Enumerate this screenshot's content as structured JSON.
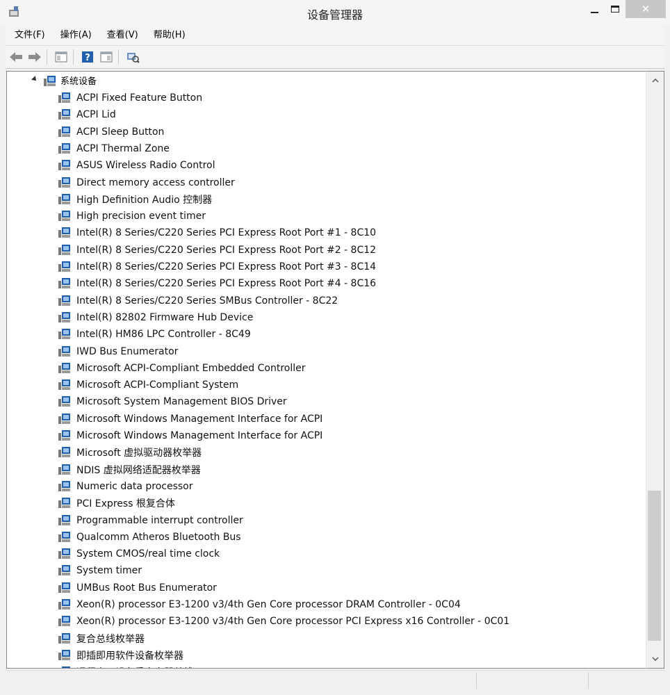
{
  "window": {
    "title": "设备管理器",
    "close_glyph": "✕"
  },
  "menu": [
    "文件(F)",
    "操作(A)",
    "查看(V)",
    "帮助(H)"
  ],
  "toolbar": {
    "buttons": [
      "back-arrow-icon",
      "forward-arrow-icon",
      "properties-icon",
      "help-icon",
      "console-icon",
      "scan-hardware-icon"
    ]
  },
  "tree": {
    "category": "系统设备",
    "devices": [
      "ACPI Fixed Feature Button",
      "ACPI Lid",
      "ACPI Sleep Button",
      "ACPI Thermal Zone",
      "ASUS Wireless Radio Control",
      "Direct memory access controller",
      "High Definition Audio 控制器",
      "High precision event timer",
      "Intel(R) 8 Series/C220 Series PCI Express Root Port #1 - 8C10",
      "Intel(R) 8 Series/C220 Series PCI Express Root Port #2 - 8C12",
      "Intel(R) 8 Series/C220 Series PCI Express Root Port #3 - 8C14",
      "Intel(R) 8 Series/C220 Series PCI Express Root Port #4 - 8C16",
      "Intel(R) 8 Series/C220 Series SMBus Controller - 8C22",
      "Intel(R) 82802 Firmware Hub Device",
      "Intel(R) HM86 LPC Controller - 8C49",
      "IWD Bus Enumerator",
      "Microsoft ACPI-Compliant Embedded Controller",
      "Microsoft ACPI-Compliant System",
      "Microsoft System Management BIOS Driver",
      "Microsoft Windows Management Interface for ACPI",
      "Microsoft Windows Management Interface for ACPI",
      "Microsoft 虚拟驱动器枚举器",
      "NDIS 虚拟网络适配器枚举器",
      "Numeric data processor",
      "PCI Express 根复合体",
      "Programmable interrupt controller",
      "Qualcomm Atheros Bluetooth Bus",
      "System CMOS/real time clock",
      "System timer",
      "UMBus Root Bus Enumerator",
      "Xeon(R) processor E3-1200 v3/4th Gen Core processor DRAM Controller - 0C04",
      "Xeon(R) processor E3-1200 v3/4th Gen Core processor PCI Express x16 Controller - 0C01",
      "复合总线枚举器",
      "即插即用软件设备枚举器",
      "远程桌面设备重定向器总线"
    ]
  },
  "colors": {
    "accent": "#1f5fae",
    "close_button": "#c7c7c7"
  }
}
